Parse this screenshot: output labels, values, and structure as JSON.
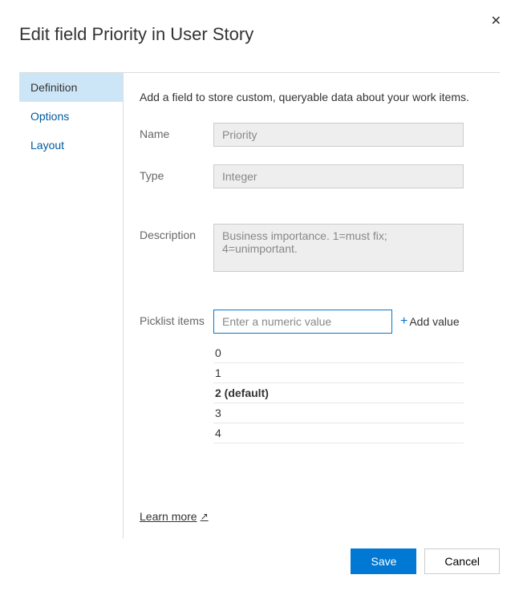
{
  "title": "Edit field Priority in User Story",
  "sidebar": {
    "items": [
      {
        "label": "Definition"
      },
      {
        "label": "Options"
      },
      {
        "label": "Layout"
      }
    ]
  },
  "main": {
    "intro": "Add a field to store custom, queryable data about your work items.",
    "name_label": "Name",
    "name_value": "Priority",
    "type_label": "Type",
    "type_value": "Integer",
    "description_label": "Description",
    "description_value": "Business importance. 1=must fix; 4=unimportant.",
    "picklist_label": "Picklist items",
    "picklist_placeholder": "Enter a numeric value",
    "add_value_label": "Add value",
    "picklist_items": [
      {
        "label": "0"
      },
      {
        "label": "1"
      },
      {
        "label": "2 (default)",
        "default": true
      },
      {
        "label": "3"
      },
      {
        "label": "4"
      }
    ],
    "learn_more": "Learn more"
  },
  "footer": {
    "save": "Save",
    "cancel": "Cancel"
  }
}
